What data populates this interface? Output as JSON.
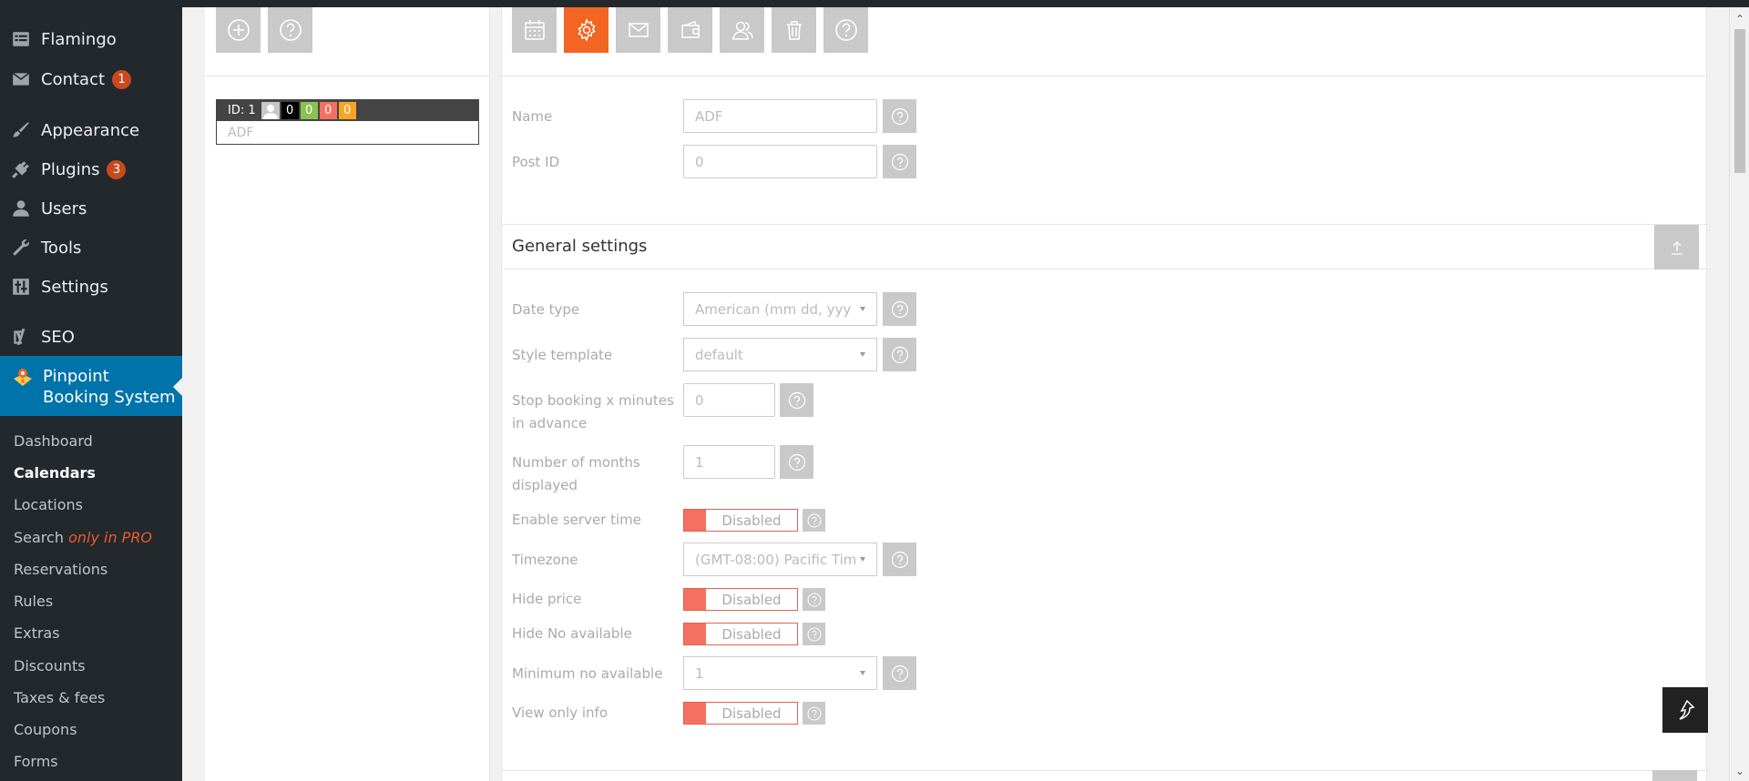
{
  "sidebar": {
    "items": [
      {
        "label": "Flamingo",
        "icon": "list-icon"
      },
      {
        "label": "Contact",
        "icon": "mail-icon",
        "badge": "1"
      },
      {
        "label": "Appearance",
        "icon": "brush-icon"
      },
      {
        "label": "Plugins",
        "icon": "plug-icon",
        "badge": "3"
      },
      {
        "label": "Users",
        "icon": "user-icon"
      },
      {
        "label": "Tools",
        "icon": "wrench-icon"
      },
      {
        "label": "Settings",
        "icon": "sliders-icon"
      },
      {
        "label": "SEO",
        "icon": "yoast-icon"
      }
    ],
    "active": {
      "label": "Pinpoint Booking System",
      "icon": "pinpoint-icon"
    },
    "submenu": [
      {
        "label": "Dashboard"
      },
      {
        "label": "Calendars"
      },
      {
        "label": "Locations"
      },
      {
        "label": "Search",
        "suffix": "only in PRO"
      },
      {
        "label": "Reservations"
      },
      {
        "label": "Rules"
      },
      {
        "label": "Extras"
      },
      {
        "label": "Discounts"
      },
      {
        "label": "Taxes & fees"
      },
      {
        "label": "Coupons"
      },
      {
        "label": "Forms"
      }
    ]
  },
  "calendar_list": {
    "item": {
      "id_label": "ID: 1",
      "counts": [
        "0",
        "0",
        "0",
        "0"
      ],
      "count_colors": [
        "#000000",
        "#8cc152",
        "#f47060",
        "#f6a623"
      ],
      "name": "ADF"
    }
  },
  "form": {
    "name_label": "Name",
    "name_value": "ADF",
    "post_id_label": "Post ID",
    "post_id_value": "0",
    "section_title": "General settings",
    "date_type_label": "Date type",
    "date_type_value": "American (mm dd, yyy",
    "style_template_label": "Style template",
    "style_template_value": "default",
    "stop_booking_label": "Stop booking x minutes in advance",
    "stop_booking_value": "0",
    "months_label": "Number of months displayed",
    "months_value": "1",
    "server_time_label": "Enable server time",
    "server_time_value": "Disabled",
    "timezone_label": "Timezone",
    "timezone_value": "(GMT-08:00) Pacific Tim",
    "hide_price_label": "Hide price",
    "hide_price_value": "Disabled",
    "hide_no_available_label": "Hide No available",
    "hide_no_available_value": "Disabled",
    "min_available_label": "Minimum no available",
    "min_available_value": "1",
    "view_only_label": "View only info",
    "view_only_value": "Disabled"
  },
  "colors": {
    "accent": "#f26522",
    "wp_blue": "#0073aa",
    "sidebar_bg": "#23282d",
    "switch_red": "#f47060"
  }
}
